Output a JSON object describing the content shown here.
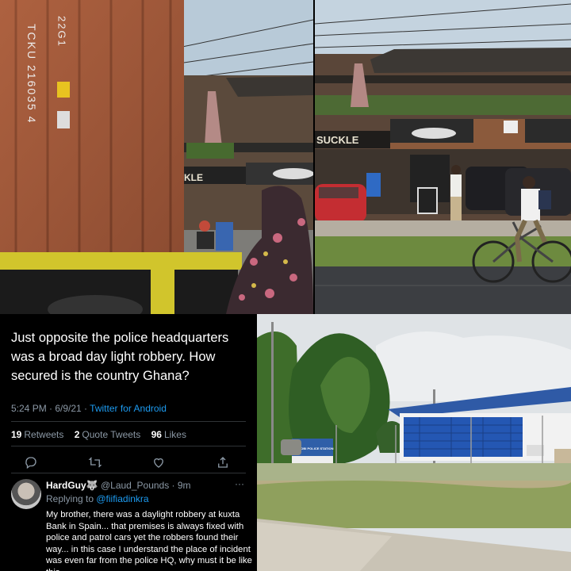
{
  "tweet": {
    "text": "Just opposite the police headquarters was a broad day light robbery. How secured is the country Ghana?",
    "time": "5:24 PM · 6/9/21 · ",
    "client": "Twitter for Android",
    "retweets": "19",
    "retweets_label": "Retweets",
    "quote_tweets": "2",
    "quote_tweets_label": "Quote Tweets",
    "likes": "96",
    "likes_label": "Likes",
    "actions": [
      "reply-icon",
      "retweet-icon",
      "like-icon",
      "share-icon"
    ]
  },
  "reply": {
    "name": "HardGuy🐺",
    "handle": "@Laud_Pounds · 9m",
    "more": "···",
    "replying_prefix": "Replying to ",
    "replying_handle": "@fiifiadinkra",
    "body": "My brother, there was a daylight robbery at kuxta Bank in Spain... that premises is always fixed with police and patrol cars yet the robbers found their way... in this case I understand the place of incident was even far from the police HQ, why must it be like this"
  },
  "photos": {
    "container_code": "TCKU 216035 4",
    "container_code_2": "22G1",
    "restaurant_sign_1": "KLE",
    "restaurant_sign_2": "SUCKLE",
    "police_sign": "ABOKOBI POLICE STATION"
  },
  "colors": {
    "twitter_blue": "#1d9bf0",
    "muted_text": "#8b98a5",
    "background": "#000000"
  }
}
